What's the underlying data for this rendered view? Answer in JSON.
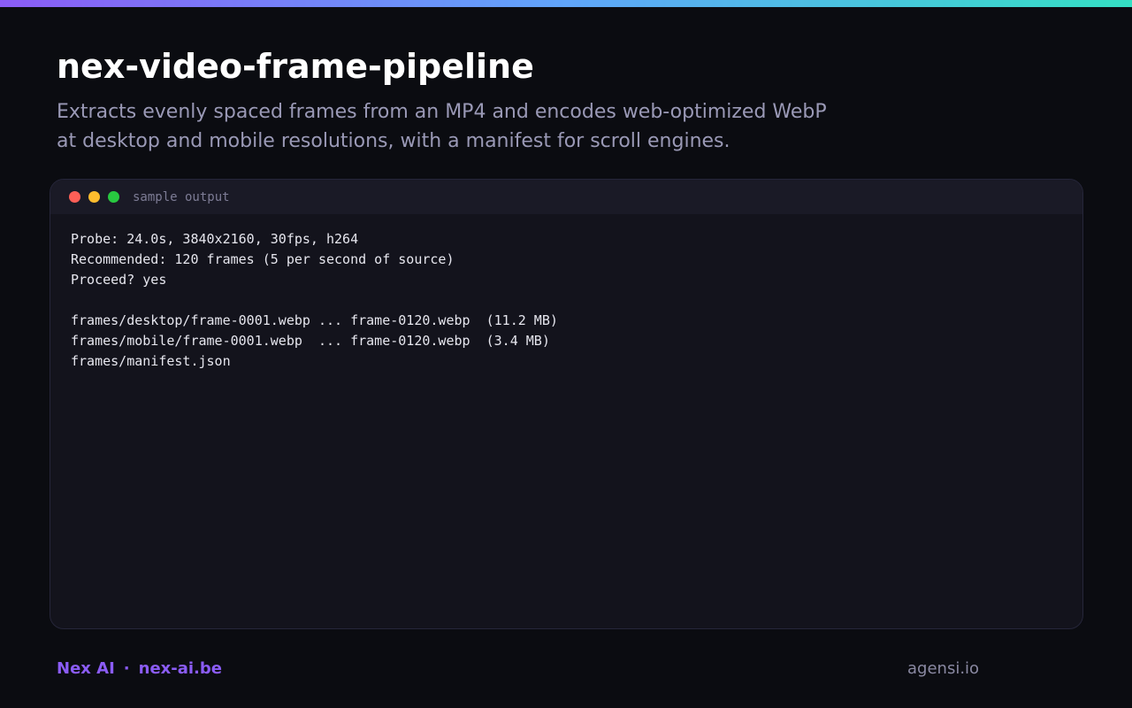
{
  "header": {
    "title": "nex-video-frame-pipeline",
    "description_lines": [
      "Extracts evenly spaced frames from an MP4 and encodes web-optimized WebP",
      "at desktop and mobile resolutions, with a manifest for scroll engines."
    ]
  },
  "terminal": {
    "label": "sample output",
    "window_buttons": [
      "close",
      "minimize",
      "maximize"
    ],
    "lines": [
      "Probe: 24.0s, 3840x2160, 30fps, h264",
      "Recommended: 120 frames (5 per second of source)",
      "Proceed? yes",
      "",
      "frames/desktop/frame-0001.webp ... frame-0120.webp  (11.2 MB)",
      "frames/mobile/frame-0001.webp  ... frame-0120.webp  (3.4 MB)",
      "frames/manifest.json"
    ]
  },
  "footer": {
    "brand": "Nex AI",
    "separator": "·",
    "link": "nex-ai.be",
    "right_text": "agensi.io"
  },
  "colors": {
    "background": "#0b0c11",
    "accent_purple": "#8b5cf6",
    "gradient_start": "#8b5cf6",
    "gradient_end": "#34e0c4",
    "terminal_bg": "#13131c",
    "dot_red": "#ff5f57",
    "dot_yellow": "#febc2e",
    "dot_green": "#28c840"
  }
}
